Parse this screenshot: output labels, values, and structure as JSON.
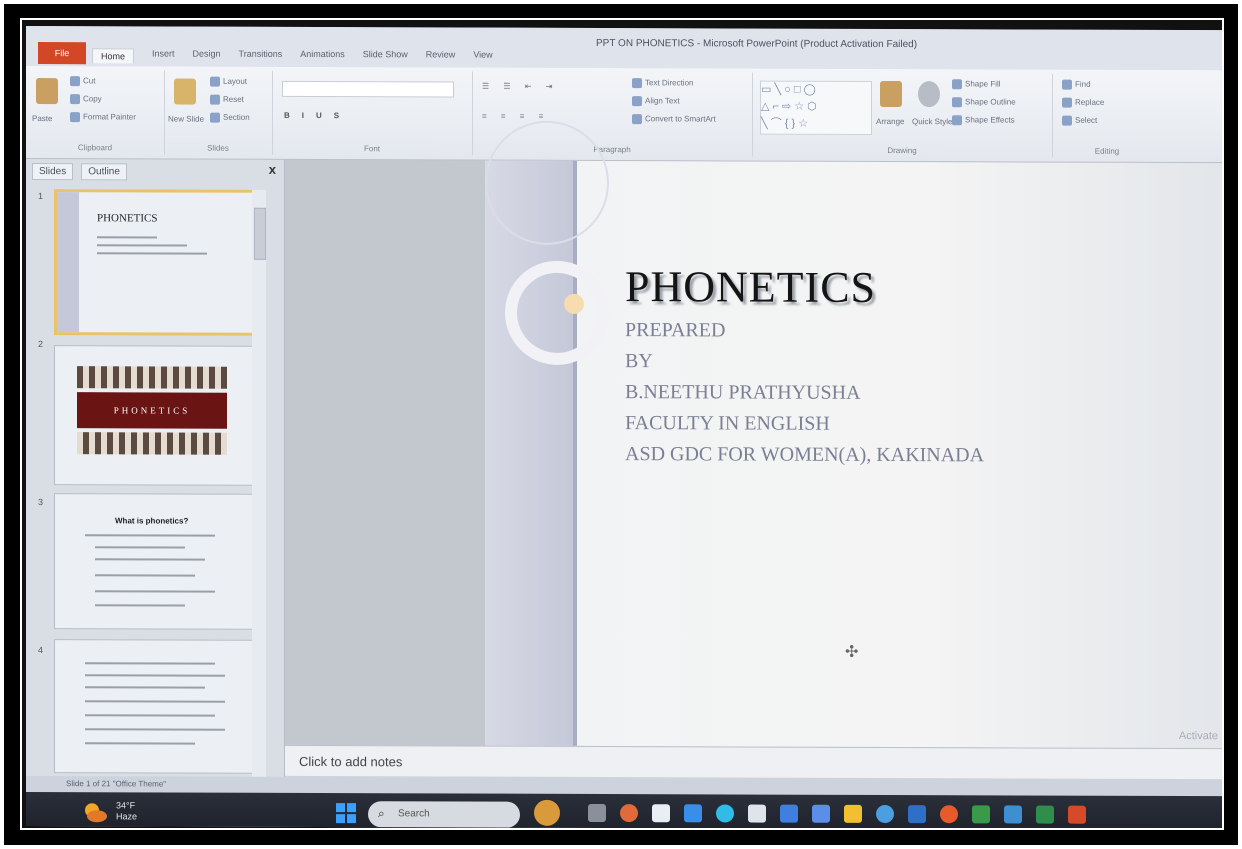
{
  "window": {
    "title": "PPT ON PHONETICS - Microsoft PowerPoint (Product Activation Failed)"
  },
  "ribbon": {
    "file_tab": "File",
    "tabs": [
      "Home",
      "Insert",
      "Design",
      "Transitions",
      "Animations",
      "Slide Show",
      "Review",
      "View"
    ],
    "clipboard": {
      "paste": "Paste",
      "cut": "Cut",
      "copy": "Copy",
      "format_painter": "Format Painter",
      "label": "Clipboard"
    },
    "slides": {
      "new_slide": "New Slide",
      "layout": "Layout",
      "reset": "Reset",
      "section": "Section",
      "label": "Slides"
    },
    "font": {
      "label": "Font"
    },
    "paragraph": {
      "text_direction": "Text Direction",
      "align_text": "Align Text",
      "convert_smartart": "Convert to SmartArt",
      "label": "Paragraph"
    },
    "drawing": {
      "arrange": "Arrange",
      "quick_styles": "Quick Styles",
      "shape_fill": "Shape Fill",
      "shape_outline": "Shape Outline",
      "shape_effects": "Shape Effects",
      "label": "Drawing"
    },
    "editing": {
      "find": "Find",
      "replace": "Replace",
      "select": "Select",
      "label": "Editing"
    }
  },
  "slides_panel": {
    "tabs": [
      "Slides",
      "Outline"
    ],
    "close": "x",
    "thumbnails": [
      {
        "number": "1",
        "title": "PHONETICS"
      },
      {
        "number": "2",
        "title": "PHONETICS"
      },
      {
        "number": "3",
        "title": "What is phonetics?"
      },
      {
        "number": "4",
        "title": ""
      }
    ]
  },
  "slide": {
    "title": "PHONETICS",
    "lines": [
      "PREPARED",
      "BY",
      "B.NEETHU PRATHYUSHA",
      "FACULTY  IN ENGLISH",
      "ASD GDC FOR WOMEN(A), KAKINADA"
    ],
    "watermark": "Activate"
  },
  "notes": {
    "placeholder": "Click to add notes"
  },
  "status": {
    "text": "Slide 1 of 21  \"Office Theme\""
  },
  "taskbar": {
    "weather_temp": "34°F",
    "weather_desc": "Haze",
    "search_placeholder": "Search"
  }
}
